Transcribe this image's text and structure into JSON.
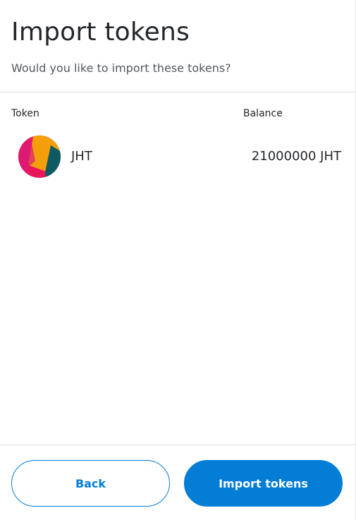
{
  "header": {
    "title": "Import tokens",
    "subtitle": "Would you like to import these tokens?"
  },
  "table": {
    "columns": {
      "token": "Token",
      "balance": "Balance"
    },
    "rows": [
      {
        "symbol": "JHT",
        "balance": "21000000 JHT",
        "icon": "jazzicon-token-avatar"
      }
    ]
  },
  "footer": {
    "back_label": "Back",
    "import_label": "Import tokens"
  },
  "colors": {
    "primary": "#037dd6",
    "text": "#24272a",
    "muted": "#535a61",
    "divider": "#d6d9dc",
    "avatar_pink": "#e8175d",
    "avatar_orange": "#f59e0b",
    "avatar_teal": "#0e5a63"
  }
}
